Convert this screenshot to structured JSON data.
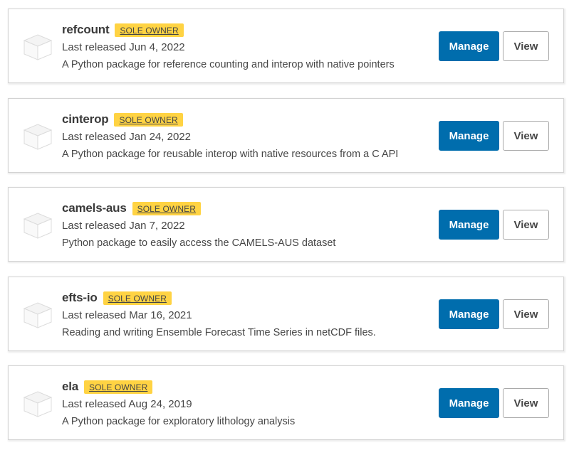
{
  "projects": [
    {
      "name": "refcount",
      "badge": "SOLE OWNER",
      "released": "Last released Jun 4, 2022",
      "summary": "A Python package for reference counting and interop with native pointers",
      "manage_label": "Manage",
      "view_label": "View"
    },
    {
      "name": "cinterop",
      "badge": "SOLE OWNER",
      "released": "Last released Jan 24, 2022",
      "summary": "A Python package for reusable interop with native resources from a C API",
      "manage_label": "Manage",
      "view_label": "View"
    },
    {
      "name": "camels-aus",
      "badge": "SOLE OWNER",
      "released": "Last released Jan 7, 2022",
      "summary": "Python package to easily access the CAMELS-AUS dataset",
      "manage_label": "Manage",
      "view_label": "View"
    },
    {
      "name": "efts-io",
      "badge": "SOLE OWNER",
      "released": "Last released Mar 16, 2021",
      "summary": "Reading and writing Ensemble Forecast Time Series in netCDF files.",
      "manage_label": "Manage",
      "view_label": "View"
    },
    {
      "name": "ela",
      "badge": "SOLE OWNER",
      "released": "Last released Aug 24, 2019",
      "summary": "A Python package for exploratory lithology analysis",
      "manage_label": "Manage",
      "view_label": "View"
    }
  ],
  "colors": {
    "manage_button": "#006dad",
    "badge": "#ffd343",
    "card_border": "#d3d3d3"
  },
  "icons": {
    "package": "package-box-icon"
  }
}
